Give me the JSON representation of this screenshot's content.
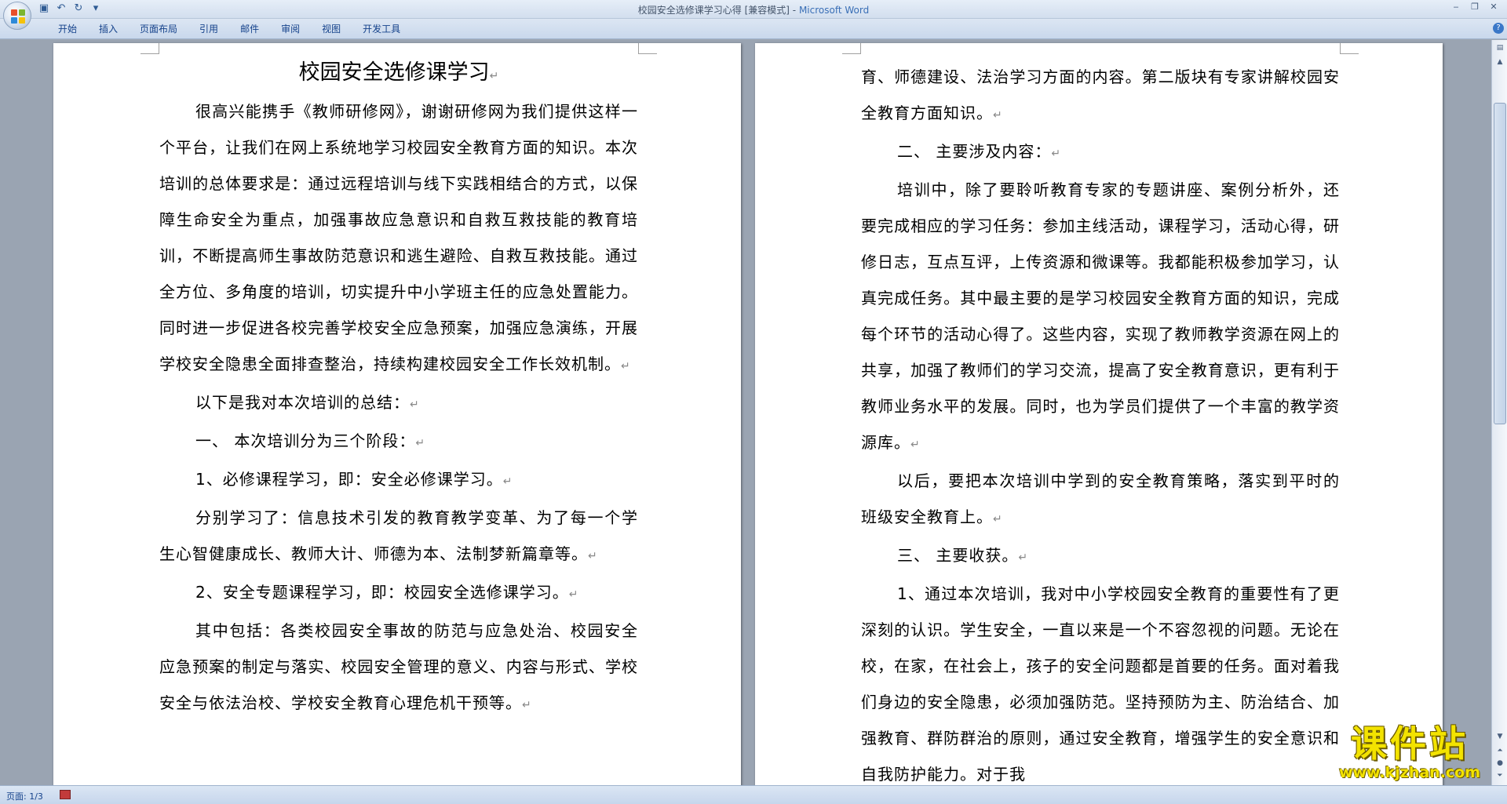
{
  "window": {
    "title_doc": "校园安全选修课学习心得 [兼容模式]",
    "title_sep": " - ",
    "title_app": "Microsoft Word",
    "controls": [
      "‒",
      "❐",
      "✕"
    ]
  },
  "qat_icons": [
    "save-icon",
    "undo-icon",
    "redo-icon",
    "customize-icon"
  ],
  "tabs": [
    "开始",
    "插入",
    "页面布局",
    "引用",
    "邮件",
    "审阅",
    "视图",
    "开发工具"
  ],
  "left_page": {
    "title": "校园安全选修课学习",
    "paragraphs": [
      "很高兴能携手《教师研修网》，谢谢研修网为我们提供这样一个平台，让我们在网上系统地学习校园安全教育方面的知识。本次培训的总体要求是：通过远程培训与线下实践相结合的方式，以保障生命安全为重点，加强事故应急意识和自救互救技能的教育培训，不断提高师生事故防范意识和逃生避险、自救互救技能。通过全方位、多角度的培训，切实提升中小学班主任的应急处置能力。同时进一步促进各校完善学校安全应急预案，加强应急演练，开展学校安全隐患全面排查整治，持续构建校园安全工作长效机制。",
      "以下是我对本次培训的总结：",
      "一、 本次培训分为三个阶段：",
      "1、必修课程学习，即：安全必修课学习。",
      "分别学习了：信息技术引发的教育教学变革、为了每一个学生心智健康成长、教师大计、师德为本、法制梦新篇章等。",
      "2、安全专题课程学习，即：校园安全选修课学习。",
      "其中包括：各类校园安全事故的防范与应急处治、校园安全应急预案的制定与落实、校园安全管理的意义、内容与形式、学校安全与依法治校、学校安全教育心理危机干预等。"
    ]
  },
  "right_page": {
    "paragraphs": [
      {
        "text": "育、师德建设、法治学习方面的内容。第二版块有专家讲解校园安全教育方面知识。",
        "indent": false
      },
      {
        "text": "二、 主要涉及内容：",
        "indent": true
      },
      {
        "text": "培训中，除了要聆听教育专家的专题讲座、案例分析外，还要完成相应的学习任务：参加主线活动，课程学习，活动心得，研修日志，互点互评，上传资源和微课等。我都能积极参加学习，认真完成任务。其中最主要的是学习校园安全教育方面的知识，完成每个环节的活动心得了。这些内容，实现了教师教学资源在网上的共享，加强了教师们的学习交流，提高了安全教育意识，更有利于教师业务水平的发展。同时，也为学员们提供了一个丰富的教学资源库。",
        "indent": true
      },
      {
        "text": "以后，要把本次培训中学到的安全教育策略，落实到平时的班级安全教育上。",
        "indent": true
      },
      {
        "text": "三、 主要收获。",
        "indent": true
      },
      {
        "text": "1、通过本次培训，我对中小学校园安全教育的重要性有了更深刻的认识。学生安全，一直以来是一个不容忽视的问题。无论在校，在家，在社会上，孩子的安全问题都是首要的任务。面对着我们身边的安全隐患，必须加强防范。坚持预防为主、防治结合、加强教育、群防群治的原则，通过安全教育，增强学生的安全意识和自我防护能力。对于我",
        "indent": true
      }
    ]
  },
  "paragraph_mark": "↵",
  "status": {
    "page_label": "页面: 1/3"
  },
  "watermark": {
    "main": "课件站",
    "sub": "www.kjzhan.com"
  },
  "colors": {
    "accent": "#15428b",
    "title_app": "#3a6fb6"
  }
}
